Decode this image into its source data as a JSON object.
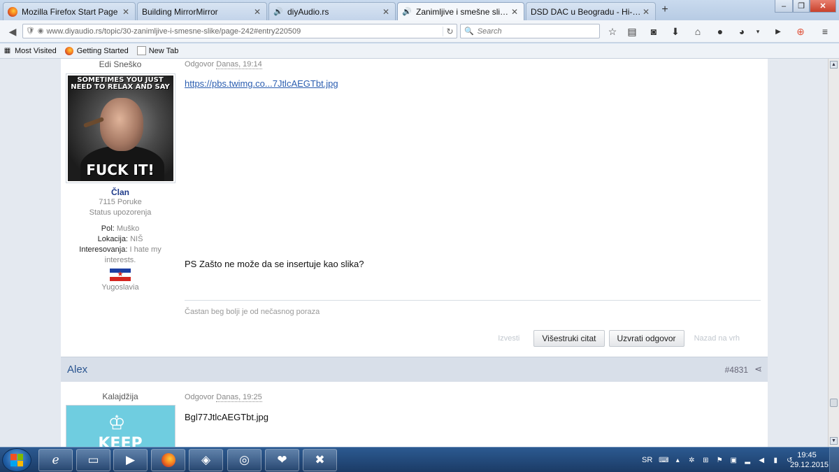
{
  "browser": {
    "tabs": [
      {
        "label": "Mozilla Firefox Start Page",
        "icon": "firefox-icon"
      },
      {
        "label": "Building MirrorMirror",
        "icon": "none"
      },
      {
        "label": "diyAudio.rs",
        "icon": "speaker-icon"
      },
      {
        "label": "Zanimljive i smešne slike - ...",
        "icon": "speaker-icon",
        "active": true
      },
      {
        "label": "DSD DAC u Beogradu - Hi-End ...",
        "icon": "none"
      }
    ],
    "new_tab_symbol": "+",
    "url": "www.diyaudio.rs/topic/30-zanimljive-i-smesne-slike/page-242#entry220509",
    "search_placeholder": "Search",
    "window_controls": {
      "minimize": "–",
      "restore": "❐",
      "close": "✕"
    },
    "bookmarks": [
      "Most Visited",
      "Getting Started",
      "New Tab"
    ]
  },
  "posts": [
    {
      "author_rank": "Edi Sneško",
      "avatar_text_top": "SOMETIMES YOU JUST NEED TO RELAX AND SAY",
      "avatar_text_bottom": "FUCK IT!",
      "group": "Član",
      "post_count": "7115 Poruke",
      "warning_status": "Status upozorenja",
      "fields": [
        {
          "label": "Pol:",
          "value": "Muško"
        },
        {
          "label": "Lokacija:",
          "value": "NIŠ"
        },
        {
          "label": "Interesovanja:",
          "value": "I hate my interests."
        }
      ],
      "country": "Yugoslavia",
      "posted_prefix": "Odgovor",
      "posted_date": "Danas, 19:14",
      "link": "https://pbs.twimg.co...7JtlcAEGTbt.jpg",
      "text": "PS Zašto ne može da se insertuje kao slika?",
      "signature": "Častan beg bolji je od nečasnog poraza",
      "actions": {
        "report": "Izvesti",
        "multiquote": "Višestruki citat",
        "reply": "Uzvrati odgovor",
        "back_to_top": "Nazad na vrh"
      }
    },
    {
      "author_name": "Alex",
      "post_number": "#4831",
      "author_rank": "Kalajdžija",
      "avatar_text": "KEEP",
      "posted_prefix": "Odgovor",
      "posted_date": "Danas, 19:25",
      "text": "Bgl77JtlcAEGTbt.jpg"
    }
  ],
  "taskbar": {
    "language": "SR",
    "time": "19:45",
    "date": "29.12.2015",
    "apps": [
      "internet-explorer-icon",
      "file-explorer-icon",
      "media-player-icon",
      "firefox-icon",
      "app-icon",
      "browser-icon",
      "heart-app-icon",
      "excel-icon"
    ]
  }
}
